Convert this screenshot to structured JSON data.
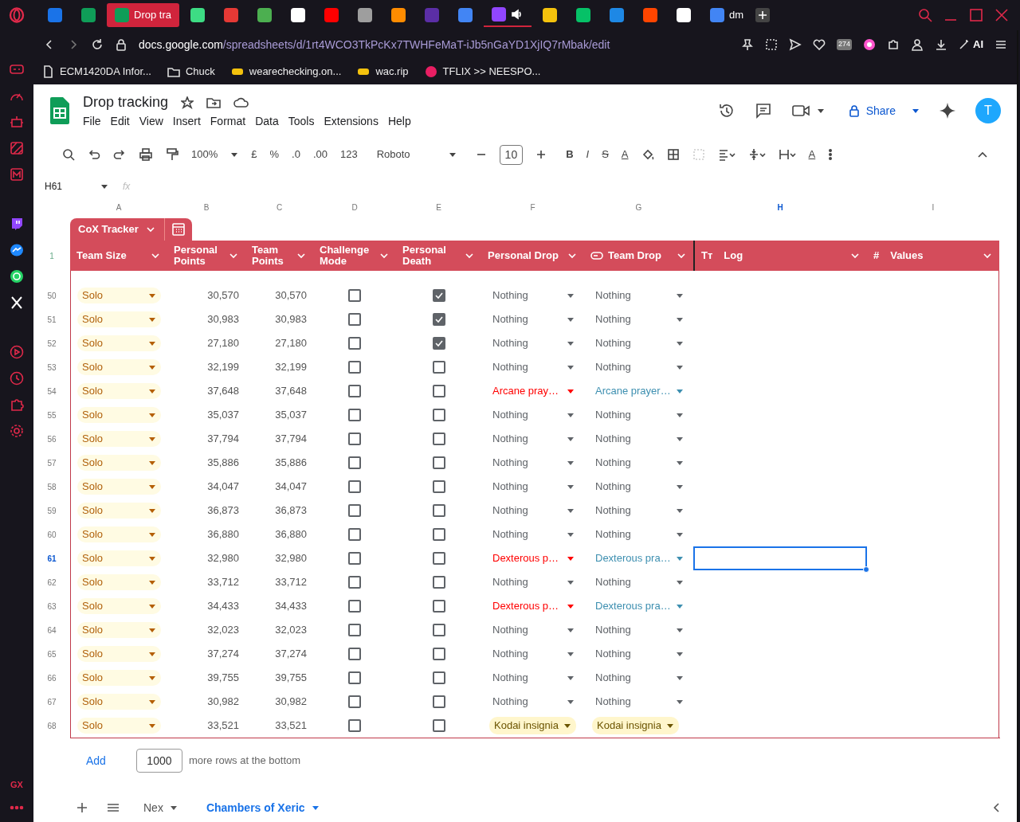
{
  "browser": {
    "tabs": [
      {
        "color": "#1a73e8",
        "selected": false
      },
      {
        "color": "#0f9d58",
        "selected": false
      },
      {
        "label": "Drop tra",
        "color": "#0f9d58",
        "selected": true
      },
      {
        "color": "#3ddc84",
        "selected": false
      },
      {
        "color": "#e53935",
        "selected": false
      },
      {
        "color": "#4caf50",
        "selected": false
      },
      {
        "color": "#ffffff",
        "selected": false
      },
      {
        "color": "#ff0000",
        "selected": false
      },
      {
        "color": "#9e9e9e",
        "selected": false
      },
      {
        "color": "#ff8c00",
        "selected": false
      },
      {
        "color": "#5b2ea6",
        "selected": false
      },
      {
        "color": "#4285f4",
        "selected": false
      },
      {
        "color": "#9146ff",
        "selected": false,
        "audio": true
      },
      {
        "color": "#f4c20d",
        "selected": false
      },
      {
        "color": "#06c167",
        "selected": false
      },
      {
        "color": "#1e88e5",
        "selected": false
      },
      {
        "color": "#ff4500",
        "selected": false
      },
      {
        "color": "#ffffff",
        "selected": false
      },
      {
        "label": "dm",
        "color": "#4285f4",
        "selected": false
      }
    ],
    "url": "**docs.google.com**/spreadsheets/d/1rt4WCO3TkPcKx7TWHFeMaT-iJb5nGaYD1XjIQ7rMbak/edit",
    "badge": "274",
    "ai_label": "AI",
    "bookmarks": [
      {
        "label": "ECM1420DA Infor..."
      },
      {
        "label": "Chuck"
      },
      {
        "label": "wearechecking.on..."
      },
      {
        "label": "wac.rip"
      },
      {
        "label": "TFLIX >> NEESPO..."
      }
    ],
    "sidebar_footer": "GX"
  },
  "doc": {
    "title": "Drop tracking",
    "menus": [
      "File",
      "Edit",
      "View",
      "Insert",
      "Format",
      "Data",
      "Tools",
      "Extensions",
      "Help"
    ],
    "share": "Share",
    "avatar": "T"
  },
  "toolbar": {
    "zoom": "100%",
    "currency": "£",
    "percent": "%",
    "dec_less": ".0",
    "dec_more": ".00",
    "number_format": "123",
    "font": "Roboto",
    "font_size": "10",
    "bold": "B",
    "italic": "I",
    "strike": "S",
    "text_color": "A",
    "rotate": "A"
  },
  "formula_bar": {
    "cell": "H61",
    "fx": "fx"
  },
  "column_letters": [
    {
      "label": "A",
      "selected": false
    },
    {
      "label": "B",
      "selected": false
    },
    {
      "label": "C",
      "selected": false
    },
    {
      "label": "D",
      "selected": false
    },
    {
      "label": "E",
      "selected": false
    },
    {
      "label": "F",
      "selected": false
    },
    {
      "label": "G",
      "selected": false
    },
    {
      "label": "H",
      "selected": true
    },
    {
      "label": "I",
      "selected": false
    }
  ],
  "table": {
    "name": "CoX Tracker",
    "header_row": "1",
    "columns": [
      {
        "label": "Team Size"
      },
      {
        "label": "Personal Points"
      },
      {
        "label": "Team Points"
      },
      {
        "label": "Challenge Mode"
      },
      {
        "label": "Personal Death"
      },
      {
        "label": "Personal Drop"
      },
      {
        "label": "Team Drop",
        "chip": true
      },
      {
        "label": "Log",
        "glyph": "Tт"
      },
      {
        "label": "Values",
        "glyph": "#"
      }
    ],
    "rows": [
      {
        "num": "50",
        "size": "Solo",
        "personal": "30,570",
        "team": "30,570",
        "cm": false,
        "death": true,
        "pdrop": {
          "text": "Nothing",
          "kind": "plain"
        },
        "tdrop": {
          "text": "Nothing",
          "kind": "plain"
        },
        "selected": false
      },
      {
        "num": "51",
        "size": "Solo",
        "personal": "30,983",
        "team": "30,983",
        "cm": false,
        "death": true,
        "pdrop": {
          "text": "Nothing",
          "kind": "plain"
        },
        "tdrop": {
          "text": "Nothing",
          "kind": "plain"
        },
        "selected": false
      },
      {
        "num": "52",
        "size": "Solo",
        "personal": "27,180",
        "team": "27,180",
        "cm": false,
        "death": true,
        "pdrop": {
          "text": "Nothing",
          "kind": "plain"
        },
        "tdrop": {
          "text": "Nothing",
          "kind": "plain"
        },
        "selected": false
      },
      {
        "num": "53",
        "size": "Solo",
        "personal": "32,199",
        "team": "32,199",
        "cm": false,
        "death": false,
        "pdrop": {
          "text": "Nothing",
          "kind": "plain"
        },
        "tdrop": {
          "text": "Nothing",
          "kind": "plain"
        },
        "selected": false
      },
      {
        "num": "54",
        "size": "Solo",
        "personal": "37,648",
        "team": "37,648",
        "cm": false,
        "death": false,
        "pdrop": {
          "text": "Arcane pray…",
          "kind": "red"
        },
        "tdrop": {
          "text": "Arcane prayer…",
          "kind": "teal"
        },
        "selected": false
      },
      {
        "num": "55",
        "size": "Solo",
        "personal": "35,037",
        "team": "35,037",
        "cm": false,
        "death": false,
        "pdrop": {
          "text": "Nothing",
          "kind": "plain"
        },
        "tdrop": {
          "text": "Nothing",
          "kind": "plain"
        },
        "selected": false
      },
      {
        "num": "56",
        "size": "Solo",
        "personal": "37,794",
        "team": "37,794",
        "cm": false,
        "death": false,
        "pdrop": {
          "text": "Nothing",
          "kind": "plain"
        },
        "tdrop": {
          "text": "Nothing",
          "kind": "plain"
        },
        "selected": false
      },
      {
        "num": "57",
        "size": "Solo",
        "personal": "35,886",
        "team": "35,886",
        "cm": false,
        "death": false,
        "pdrop": {
          "text": "Nothing",
          "kind": "plain"
        },
        "tdrop": {
          "text": "Nothing",
          "kind": "plain"
        },
        "selected": false
      },
      {
        "num": "58",
        "size": "Solo",
        "personal": "34,047",
        "team": "34,047",
        "cm": false,
        "death": false,
        "pdrop": {
          "text": "Nothing",
          "kind": "plain"
        },
        "tdrop": {
          "text": "Nothing",
          "kind": "plain"
        },
        "selected": false
      },
      {
        "num": "59",
        "size": "Solo",
        "personal": "36,873",
        "team": "36,873",
        "cm": false,
        "death": false,
        "pdrop": {
          "text": "Nothing",
          "kind": "plain"
        },
        "tdrop": {
          "text": "Nothing",
          "kind": "plain"
        },
        "selected": false
      },
      {
        "num": "60",
        "size": "Solo",
        "personal": "36,880",
        "team": "36,880",
        "cm": false,
        "death": false,
        "pdrop": {
          "text": "Nothing",
          "kind": "plain"
        },
        "tdrop": {
          "text": "Nothing",
          "kind": "plain"
        },
        "selected": false
      },
      {
        "num": "61",
        "size": "Solo",
        "personal": "32,980",
        "team": "32,980",
        "cm": false,
        "death": false,
        "pdrop": {
          "text": "Dexterous p…",
          "kind": "red"
        },
        "tdrop": {
          "text": "Dexterous pra…",
          "kind": "teal"
        },
        "selected": true
      },
      {
        "num": "62",
        "size": "Solo",
        "personal": "33,712",
        "team": "33,712",
        "cm": false,
        "death": false,
        "pdrop": {
          "text": "Nothing",
          "kind": "plain"
        },
        "tdrop": {
          "text": "Nothing",
          "kind": "plain"
        },
        "selected": false
      },
      {
        "num": "63",
        "size": "Solo",
        "personal": "34,433",
        "team": "34,433",
        "cm": false,
        "death": false,
        "pdrop": {
          "text": "Dexterous p…",
          "kind": "red"
        },
        "tdrop": {
          "text": "Dexterous pra…",
          "kind": "teal"
        },
        "selected": false
      },
      {
        "num": "64",
        "size": "Solo",
        "personal": "32,023",
        "team": "32,023",
        "cm": false,
        "death": false,
        "pdrop": {
          "text": "Nothing",
          "kind": "plain"
        },
        "tdrop": {
          "text": "Nothing",
          "kind": "plain"
        },
        "selected": false
      },
      {
        "num": "65",
        "size": "Solo",
        "personal": "37,274",
        "team": "37,274",
        "cm": false,
        "death": false,
        "pdrop": {
          "text": "Nothing",
          "kind": "plain"
        },
        "tdrop": {
          "text": "Nothing",
          "kind": "plain"
        },
        "selected": false
      },
      {
        "num": "66",
        "size": "Solo",
        "personal": "39,755",
        "team": "39,755",
        "cm": false,
        "death": false,
        "pdrop": {
          "text": "Nothing",
          "kind": "plain"
        },
        "tdrop": {
          "text": "Nothing",
          "kind": "plain"
        },
        "selected": false
      },
      {
        "num": "67",
        "size": "Solo",
        "personal": "30,982",
        "team": "30,982",
        "cm": false,
        "death": false,
        "pdrop": {
          "text": "Nothing",
          "kind": "plain"
        },
        "tdrop": {
          "text": "Nothing",
          "kind": "plain"
        },
        "selected": false
      },
      {
        "num": "68",
        "size": "Solo",
        "personal": "33,521",
        "team": "33,521",
        "cm": false,
        "death": false,
        "pdrop": {
          "text": "Kodai insignia",
          "kind": "chip"
        },
        "tdrop": {
          "text": "Kodai insignia",
          "kind": "chip"
        },
        "selected": false
      }
    ]
  },
  "add_rows": {
    "button": "Add",
    "count": "1000",
    "suffix": "more rows at the bottom"
  },
  "sheets": [
    {
      "label": "Nex",
      "selected": false
    },
    {
      "label": "Chambers of Xeric",
      "selected": true
    }
  ]
}
